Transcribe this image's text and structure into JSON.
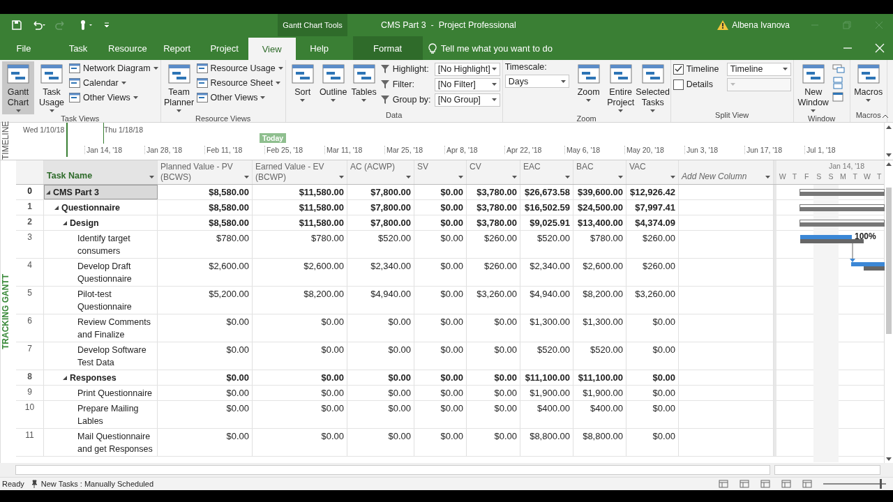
{
  "title_bar": {
    "context_label": "Gantt Chart Tools",
    "title": "CMS Part 3  -  Project Professional",
    "user": "Albena Ivanova"
  },
  "tabs": [
    {
      "label": "File",
      "selected": false,
      "kind": "normal"
    },
    {
      "label": "Task",
      "selected": false,
      "kind": "normal"
    },
    {
      "label": "Resource",
      "selected": false,
      "kind": "normal"
    },
    {
      "label": "Report",
      "selected": false,
      "kind": "normal"
    },
    {
      "label": "Project",
      "selected": false,
      "kind": "normal"
    },
    {
      "label": "View",
      "selected": true,
      "kind": "normal"
    },
    {
      "label": "Help",
      "selected": false,
      "kind": "normal"
    },
    {
      "label": "Format",
      "selected": false,
      "kind": "context"
    }
  ],
  "tell_me": {
    "placeholder": "Tell me what you want to do"
  },
  "ribbon": [
    {
      "kind": "views",
      "label": "Task Views",
      "large": [
        {
          "label": "Gantt Chart",
          "selected": true
        },
        {
          "label": "Task Usage",
          "selected": false
        }
      ],
      "small": [
        "Network Diagram",
        "Calendar",
        "Other Views"
      ]
    },
    {
      "kind": "views",
      "label": "Resource Views",
      "large": [
        {
          "label": "Team Planner",
          "selected": false
        }
      ],
      "small": [
        "Resource Usage",
        "Resource Sheet",
        "Other Views"
      ]
    },
    {
      "kind": "data",
      "label": "Data",
      "large": [
        {
          "label": "Sort",
          "selected": false
        },
        {
          "label": "Outline",
          "selected": false
        },
        {
          "label": "Tables",
          "selected": false
        }
      ],
      "fields": [
        {
          "label": "Highlight:",
          "value": "[No Highlight]"
        },
        {
          "label": "Filter:",
          "value": "[No Filter]"
        },
        {
          "label": "Group by:",
          "value": "[No Group]"
        }
      ]
    },
    {
      "kind": "zoom",
      "label": "Zoom",
      "fields": [
        {
          "label": "Timescale:",
          "value": "Days"
        }
      ],
      "large": [
        {
          "label": "Zoom",
          "selected": false
        },
        {
          "label": "Entire Project",
          "selected": false
        },
        {
          "label": "Selected Tasks",
          "selected": false
        }
      ]
    },
    {
      "kind": "split",
      "label": "Split View",
      "checks": [
        {
          "label": "Timeline",
          "checked": true,
          "value": "Timeline"
        },
        {
          "label": "Details",
          "checked": false
        }
      ]
    },
    {
      "kind": "window",
      "label": "Window",
      "large": [
        {
          "label": "New Window",
          "selected": false
        }
      ]
    },
    {
      "kind": "plain",
      "label": "Macros",
      "large": [
        {
          "label": "Macros",
          "selected": false
        }
      ]
    }
  ],
  "timeline": {
    "side_label": "TIMELINE",
    "start": "Wed 1/10/18",
    "current": "Thu 1/18/18",
    "today": "Today",
    "ticks": [
      "Jan 14, '18",
      "Jan 28, '18",
      "Feb 11, '18",
      "Feb 25, '18",
      "Mar 11, '18",
      "Mar 25, '18",
      "Apr 8, '18",
      "Apr 22, '18",
      "May 6, '18",
      "May 20, '18",
      "Jun 3, '18",
      "Jun 17, '18",
      "Jul 1, '18"
    ]
  },
  "view_label": "TRACKING GANTT",
  "table": {
    "columns": [
      {
        "label": "Task Name",
        "kind": "name"
      },
      {
        "label": "Planned Value - PV (BCWS)",
        "kind": "field"
      },
      {
        "label": "Earned Value - EV (BCWP)",
        "kind": "field"
      },
      {
        "label": "AC (ACWP)",
        "kind": "field"
      },
      {
        "label": "SV",
        "kind": "field"
      },
      {
        "label": "CV",
        "kind": "field"
      },
      {
        "label": "EAC",
        "kind": "field"
      },
      {
        "label": "BAC",
        "kind": "field"
      },
      {
        "label": "VAC",
        "kind": "field"
      },
      {
        "label": "Add New Column",
        "kind": "add"
      }
    ],
    "rows": [
      {
        "id": "0",
        "summary": true,
        "expanded": true,
        "selected": true,
        "cells": [
          "CMS Part 3",
          "$8,580.00",
          "$11,580.00",
          "$7,800.00",
          "$0.00",
          "$3,780.00",
          "$26,673.58",
          "$39,600.00",
          "$12,926.42"
        ],
        "children": [
          {
            "id": "1",
            "summary": true,
            "expanded": true,
            "selected": false,
            "cells": [
              "Questionnaire",
              "$8,580.00",
              "$11,580.00",
              "$7,800.00",
              "$0.00",
              "$3,780.00",
              "$16,502.59",
              "$24,500.00",
              "$7,997.41"
            ],
            "children": [
              {
                "id": "2",
                "summary": true,
                "expanded": true,
                "selected": false,
                "cells": [
                  "Design",
                  "$8,580.00",
                  "$11,580.00",
                  "$7,800.00",
                  "$0.00",
                  "$3,780.00",
                  "$9,025.91",
                  "$13,400.00",
                  "$4,374.09"
                ],
                "children": [
                  {
                    "id": "3",
                    "summary": false,
                    "selected": false,
                    "cells": [
                      "Identify target consumers",
                      "$780.00",
                      "$780.00",
                      "$520.00",
                      "$0.00",
                      "$260.00",
                      "$520.00",
                      "$780.00",
                      "$260.00"
                    ]
                  },
                  {
                    "id": "4",
                    "summary": false,
                    "selected": false,
                    "cells": [
                      "Develop Draft Questionnaire",
                      "$2,600.00",
                      "$2,600.00",
                      "$2,340.00",
                      "$0.00",
                      "$260.00",
                      "$2,340.00",
                      "$2,600.00",
                      "$260.00"
                    ]
                  },
                  {
                    "id": "5",
                    "summary": false,
                    "selected": false,
                    "cells": [
                      "Pilot-test Questionnaire",
                      "$5,200.00",
                      "$8,200.00",
                      "$4,940.00",
                      "$0.00",
                      "$3,260.00",
                      "$4,940.00",
                      "$8,200.00",
                      "$3,260.00"
                    ]
                  },
                  {
                    "id": "6",
                    "summary": false,
                    "selected": false,
                    "cells": [
                      "Review Comments and Finalize",
                      "$0.00",
                      "$0.00",
                      "$0.00",
                      "$0.00",
                      "$0.00",
                      "$1,300.00",
                      "$1,300.00",
                      "$0.00"
                    ]
                  },
                  {
                    "id": "7",
                    "summary": false,
                    "selected": false,
                    "cells": [
                      "Develop Software Test Data",
                      "$0.00",
                      "$0.00",
                      "$0.00",
                      "$0.00",
                      "$0.00",
                      "$520.00",
                      "$520.00",
                      "$0.00"
                    ]
                  }
                ]
              },
              {
                "id": "8",
                "summary": true,
                "expanded": true,
                "selected": false,
                "cells": [
                  "Responses",
                  "$0.00",
                  "$0.00",
                  "$0.00",
                  "$0.00",
                  "$0.00",
                  "$11,100.00",
                  "$11,100.00",
                  "$0.00"
                ],
                "children": [
                  {
                    "id": "9",
                    "summary": false,
                    "selected": false,
                    "cells": [
                      "Print Questionnaire",
                      "$0.00",
                      "$0.00",
                      "$0.00",
                      "$0.00",
                      "$0.00",
                      "$1,900.00",
                      "$1,900.00",
                      "$0.00"
                    ]
                  },
                  {
                    "id": "10",
                    "summary": false,
                    "selected": false,
                    "cells": [
                      "Prepare Mailing Lables",
                      "$0.00",
                      "$0.00",
                      "$0.00",
                      "$0.00",
                      "$0.00",
                      "$400.00",
                      "$400.00",
                      "$0.00"
                    ]
                  },
                  {
                    "id": "11",
                    "summary": false,
                    "selected": false,
                    "cells": [
                      "Mail Questionnaire and get Responses",
                      "$0.00",
                      "$0.00",
                      "$0.00",
                      "$0.00",
                      "$0.00",
                      "$8,800.00",
                      "$8,800.00",
                      "$0.00"
                    ]
                  }
                ]
              }
            ]
          }
        ]
      }
    ]
  },
  "gantt": {
    "date_label": "Jan 14, '18",
    "days": [
      "W",
      "T",
      "F",
      "S",
      "S",
      "M",
      "T",
      "W",
      "T"
    ],
    "percent_label": "100%"
  },
  "status_bar": {
    "state": "Ready",
    "new_tasks": "New Tasks : Manually Scheduled",
    "zoom_slider": {
      "level": 0.93
    }
  }
}
